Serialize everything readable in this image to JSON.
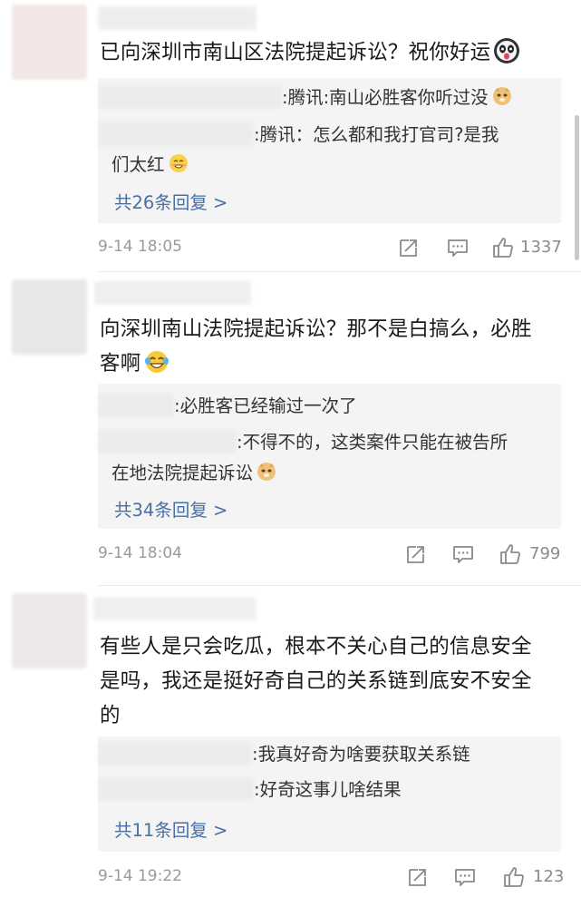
{
  "comments": [
    {
      "text": "已向深圳市南山区法院提起诉讼？祝你好运",
      "emoji": "panda-emoji",
      "replies": [
        {
          "text": ":腾讯:南山必胜客你听过没",
          "emoji": "doge-emoji"
        },
        {
          "text": ":腾讯：怎么都和我打官司?是我们太红",
          "emoji": "grin-emoji"
        }
      ],
      "more": "共26条回复 >",
      "date": "9-14 18:05",
      "likes": "1337"
    },
    {
      "text": "向深圳南山法院提起诉讼？那不是白搞么，必胜客啊",
      "emoji": "laugh-cry-emoji",
      "replies": [
        {
          "text": ":必胜客已经输过一次了",
          "emoji": ""
        },
        {
          "text": ":不得不的，这类案件只能在被告所在地法院提起诉讼",
          "emoji": "doge-emoji"
        }
      ],
      "more": "共34条回复 >",
      "date": "9-14 18:04",
      "likes": "799"
    },
    {
      "text": "有些人是只会吃瓜，根本不关心自己的信息安全是吗，我还是挺好奇自己的关系链到底安不安全的",
      "emoji": "",
      "replies": [
        {
          "text": ":我真好奇为啥要获取关系链",
          "emoji": ""
        },
        {
          "text": ":好奇这事儿啥结果",
          "emoji": ""
        }
      ],
      "more": "共11条回复 >",
      "date": "9-14 19:22",
      "likes": "123"
    }
  ],
  "c1": {
    "line1": "已向深圳市南山区法院提起诉讼？祝你好运",
    "r1": ":腾讯:南山必胜客你听过没",
    "r2a": ":腾讯：怎么都和我打官司?是我",
    "r2b": "们太红",
    "more": "共26条回复 >",
    "date": "9-14 18:05",
    "likes": "1337"
  },
  "c2": {
    "line1": "向深圳南山法院提起诉讼？那不是白搞么，必胜",
    "line2": "客啊",
    "r1": ":必胜客已经输过一次了",
    "r2a": ":不得不的，这类案件只能在被告所",
    "r2b": "在地法院提起诉讼",
    "more": "共34条回复 >",
    "date": "9-14 18:04",
    "likes": "799"
  },
  "c3": {
    "line1": "有些人是只会吃瓜，根本不关心自己的信息安全",
    "line2": "是吗，我还是挺好奇自己的关系链到底安不安全",
    "line3": "的",
    "r1": ":我真好奇为啥要获取关系链",
    "r2": ":好奇这事儿啥结果",
    "more": "共11条回复 >",
    "date": "9-14 19:22",
    "likes": "123"
  },
  "icons": {
    "forward": "share-icon",
    "comment": "comment-icon",
    "like": "thumbs-up-icon"
  },
  "colors": {
    "link": "#4a6fa3",
    "reply_bg": "#f4f4f4",
    "meta": "#9a9a9a"
  }
}
